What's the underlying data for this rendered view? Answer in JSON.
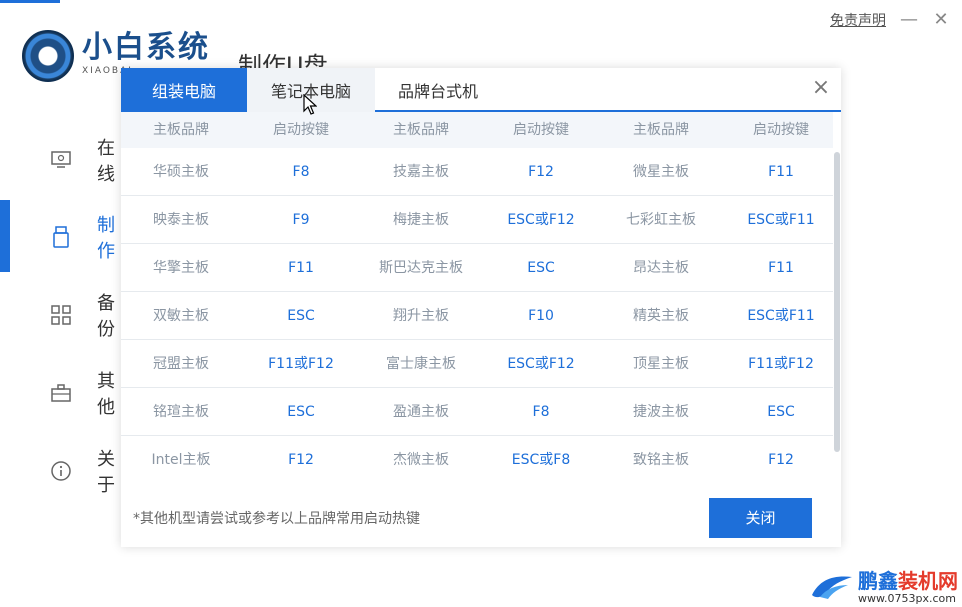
{
  "app": {
    "logo_cn": "小白系统",
    "logo_en": "XIAOBAI",
    "title": "制作U盘",
    "disclaimer": "免责声明",
    "minimize": "—",
    "close": "✕"
  },
  "sidebar": {
    "items": [
      {
        "label": "在线",
        "icon": "monitor-icon"
      },
      {
        "label": "制作",
        "icon": "usb-icon"
      },
      {
        "label": "备份",
        "icon": "grid-icon"
      },
      {
        "label": "其他",
        "icon": "toolbox-icon"
      },
      {
        "label": "关于",
        "icon": "info-icon"
      }
    ]
  },
  "modal": {
    "tabs": [
      {
        "label": "组装电脑",
        "state": "active"
      },
      {
        "label": "笔记本电脑",
        "state": "hover"
      },
      {
        "label": "品牌台式机",
        "state": "normal"
      }
    ],
    "close_icon": "×",
    "headers": [
      "主板品牌",
      "启动按键",
      "主板品牌",
      "启动按键",
      "主板品牌",
      "启动按键"
    ],
    "rows": [
      [
        "华硕主板",
        "F8",
        "技嘉主板",
        "F12",
        "微星主板",
        "F11"
      ],
      [
        "映泰主板",
        "F9",
        "梅捷主板",
        "ESC或F12",
        "七彩虹主板",
        "ESC或F11"
      ],
      [
        "华擎主板",
        "F11",
        "斯巴达克主板",
        "ESC",
        "昂达主板",
        "F11"
      ],
      [
        "双敏主板",
        "ESC",
        "翔升主板",
        "F10",
        "精英主板",
        "ESC或F11"
      ],
      [
        "冠盟主板",
        "F11或F12",
        "富士康主板",
        "ESC或F12",
        "顶星主板",
        "F11或F12"
      ],
      [
        "铭瑄主板",
        "ESC",
        "盈通主板",
        "F8",
        "捷波主板",
        "ESC"
      ],
      [
        "Intel主板",
        "F12",
        "杰微主板",
        "ESC或F8",
        "致铭主板",
        "F12"
      ]
    ],
    "footer_note": "*其他机型请尝试或参考以上品牌常用启动热键",
    "close_button": "关闭"
  },
  "watermark": {
    "name_part1": "鹏鑫",
    "name_part2": "装机网",
    "url": "www.0753px.com"
  },
  "colors": {
    "accent": "#1e6fd9",
    "brand_text": "#8b96a3",
    "watermark_red": "#e43b2c"
  }
}
